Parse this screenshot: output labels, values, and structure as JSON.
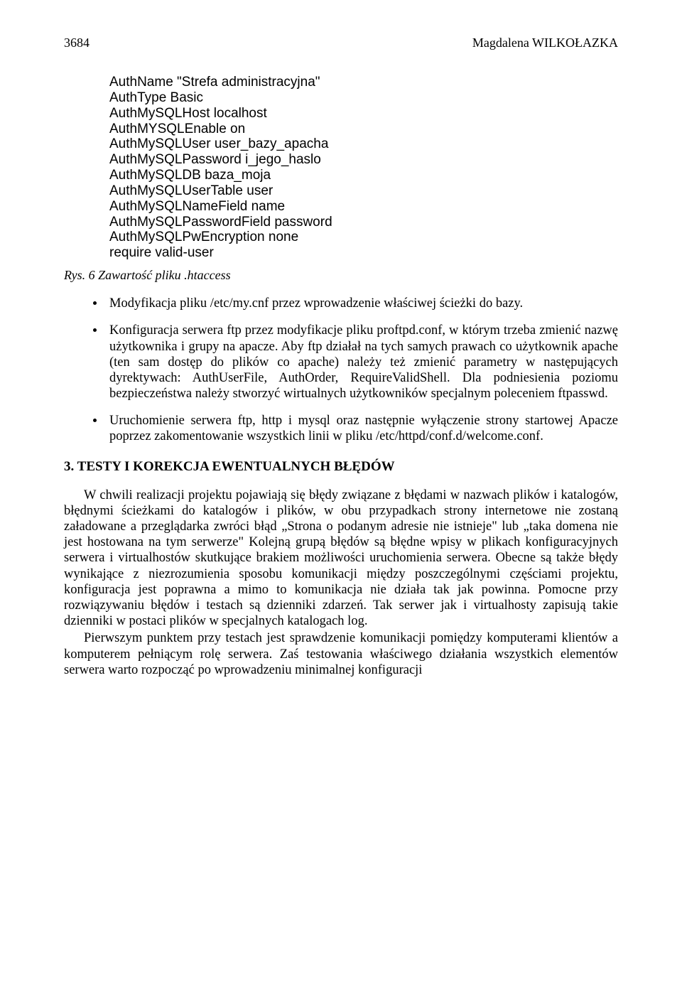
{
  "header": {
    "page_number": "3684",
    "author": "Magdalena WILKOŁAZKA"
  },
  "code": {
    "l1": "AuthName \"Strefa administracyjna\"",
    "l2": "AuthType Basic",
    "l3": "AuthMySQLHost localhost",
    "l4": "AuthMYSQLEnable on",
    "l5": "AuthMySQLUser user_bazy_apacha",
    "l6": "AuthMySQLPassword i_jego_haslo",
    "l7": "AuthMySQLDB baza_moja",
    "l8": "AuthMySQLUserTable user",
    "l9": "AuthMySQLNameField name",
    "l10": "AuthMySQLPasswordField password",
    "l11": "AuthMySQLPwEncryption none",
    "l12": "require valid-user"
  },
  "figure_caption": "Rys. 6 Zawartość pliku .htaccess",
  "bullets": {
    "b1": "Modyfikacja pliku /etc/my.cnf przez wprowadzenie właściwej ścieżki do bazy.",
    "b2": "Konfiguracja serwera ftp przez modyfikacje pliku proftpd.conf, w którym trzeba zmienić nazwę użytkownika i grupy na apacze. Aby ftp działał na tych samych prawach co użytkownik apache (ten sam dostęp do plików co apache) należy też zmienić parametry w  następujących dyrektywach: AuthUserFile, AuthOrder, RequireValidShell. Dla podniesienia poziomu bezpieczeństwa należy stworzyć wirtualnych użytkowników specjalnym poleceniem ftpasswd.",
    "b3": "Uruchomienie serwera ftp, http i mysql oraz następnie wyłączenie strony startowej Apacze poprzez zakomentowanie wszystkich linii w pliku /etc/httpd/conf.d/welcome.conf."
  },
  "section_heading": "3. TESTY I KOREKCJA EWENTUALNYCH BŁĘDÓW",
  "paragraphs": {
    "p1": "W chwili realizacji projektu pojawiają się błędy związane z błędami w nazwach plików i katalogów, błędnymi ścieżkami do katalogów i plików, w obu przypadkach strony internetowe nie zostaną załadowane a przeglądarka zwróci błąd „Strona o podanym adresie nie istnieje\" lub „taka domena nie jest hostowana na tym serwerze\" Kolejną grupą błędów są błędne wpisy w plikach konfiguracyjnych serwera i virtualhostów skutkujące brakiem możliwości uruchomienia serwera. Obecne są także błędy wynikające z niezrozumienia sposobu komunikacji między poszczególnymi częściami projektu, konfiguracja jest poprawna a mimo to komunikacja nie działa tak jak powinna. Pomocne przy rozwiązywaniu błędów i testach są dzienniki zdarzeń. Tak serwer jak i virtualhosty zapisują takie dzienniki w postaci plików w specjalnych katalogach log.",
    "p2": "Pierwszym punktem przy testach jest sprawdzenie komunikacji pomiędzy komputerami klientów a komputerem pełniącym rolę serwera. Zaś testowania właściwego działania wszystkich elementów serwera warto rozpocząć po wprowadzeniu minimalnej konfiguracji"
  }
}
